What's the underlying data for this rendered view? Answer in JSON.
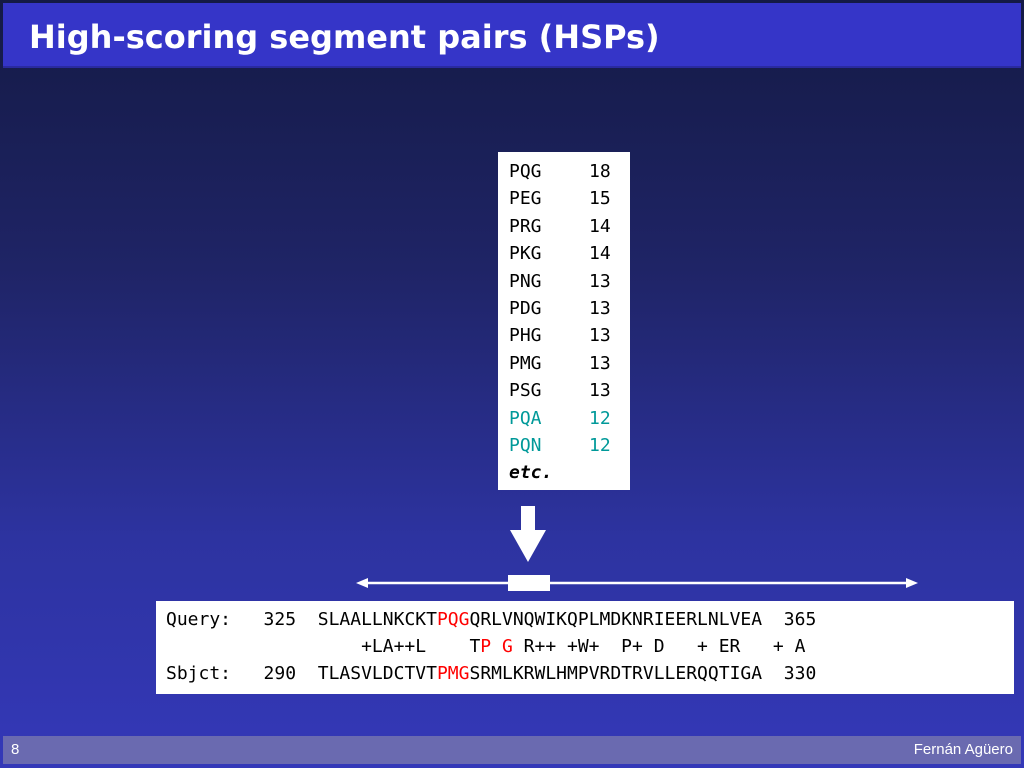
{
  "slide": {
    "title": "High-scoring segment pairs (HSPs)",
    "slide_number": "8",
    "author": "Fernán Agüero"
  },
  "scores": {
    "rows": [
      {
        "triplet": "PQG",
        "score": "18",
        "highlight": false
      },
      {
        "triplet": "PEG",
        "score": "15",
        "highlight": false
      },
      {
        "triplet": "PRG",
        "score": "14",
        "highlight": false
      },
      {
        "triplet": "PKG",
        "score": "14",
        "highlight": false
      },
      {
        "triplet": "PNG",
        "score": "13",
        "highlight": false
      },
      {
        "triplet": "PDG",
        "score": "13",
        "highlight": false
      },
      {
        "triplet": "PHG",
        "score": "13",
        "highlight": false
      },
      {
        "triplet": "PMG",
        "score": "13",
        "highlight": false
      },
      {
        "triplet": "PSG",
        "score": "13",
        "highlight": false
      },
      {
        "triplet": "PQA",
        "score": "12",
        "highlight": true
      },
      {
        "triplet": "PQN",
        "score": "12",
        "highlight": true
      }
    ],
    "etc": "etc.",
    "highlight_color": "#009999"
  },
  "alignment": {
    "query": {
      "label": "Query:",
      "start": "325",
      "seq_before": "SLAALLNKCKT",
      "seq_hit": "PQG",
      "seq_after": "QRLVNQWIKQPLMDKNRIEERLNLVEA",
      "end": "365"
    },
    "match": {
      "before": "+LA++L    T",
      "hit": "P G",
      "after": " R++ +W+  P+ D   + ER   + A"
    },
    "subject": {
      "label": "Sbjct:",
      "start": "290",
      "seq_before": "TLASVLDCTVT",
      "seq_hit": "PMG",
      "seq_after": "SRMLKRWLHMPVRDTRVLLERQQTIGA",
      "end": "330"
    },
    "hit_color": "#ff0000"
  },
  "icons": {
    "arrow": "down-arrow-icon",
    "range": "double-headed-arrow-icon"
  }
}
